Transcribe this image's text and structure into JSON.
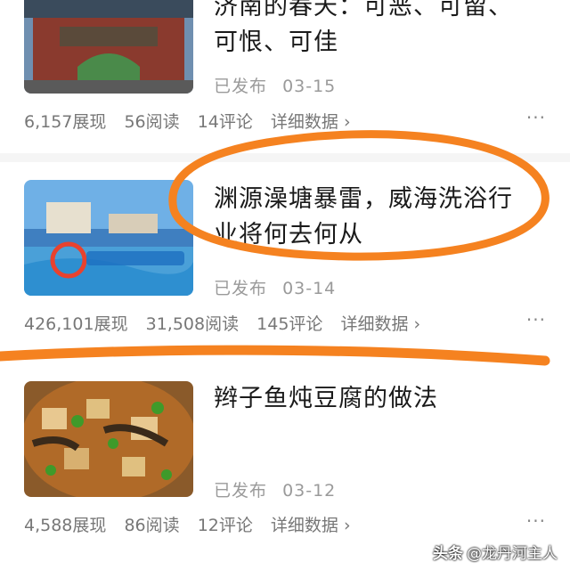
{
  "articles": [
    {
      "title": "济南的春天：可恶、可留、可恨、可佳",
      "title_line1": "济南的春天：可恶、可留、",
      "title_line2": "可恨、可佳",
      "status": "已发布",
      "date": "03-15",
      "impressions": "6,157展现",
      "reads": "56阅读",
      "comments": "14评论",
      "detail": "详细数据 ›",
      "more": "···"
    },
    {
      "title_line1": "渊源澡塘暴雷，威海洗浴行",
      "title_line2": "业将何去何从",
      "status": "已发布",
      "date": "03-14",
      "impressions": "426,101展现",
      "reads": "31,508阅读",
      "comments": "145评论",
      "detail": "详细数据 ›",
      "more": "···"
    },
    {
      "title": "辫子鱼炖豆腐的做法",
      "status": "已发布",
      "date": "03-12",
      "impressions": "4,588展现",
      "reads": "86阅读",
      "comments": "12评论",
      "detail": "详细数据 ›",
      "more": "···"
    }
  ],
  "watermark": {
    "logo": "头条",
    "text": "@龙丹河主人"
  },
  "colors": {
    "highlight": "#f58220",
    "stat_text": "#777777",
    "date_text": "#9a9a9a"
  },
  "icons": [
    "more-icon",
    "chevron-right-icon"
  ]
}
